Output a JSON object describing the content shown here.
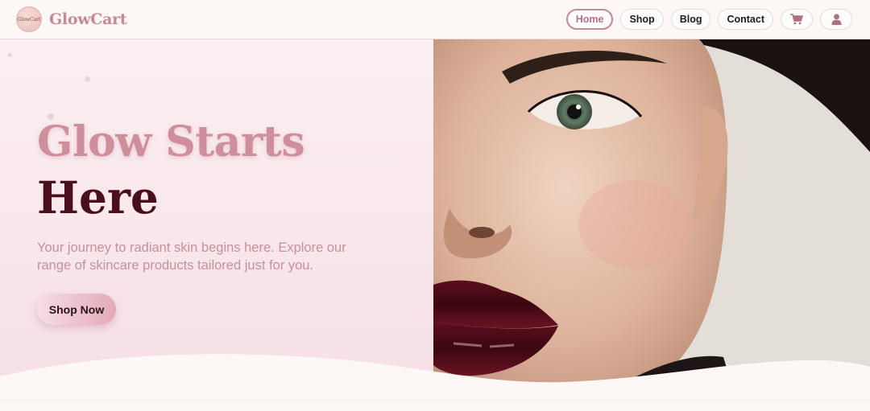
{
  "header": {
    "brand": "GlowCart",
    "logo_text": "GlowCart",
    "nav": [
      {
        "label": "Home",
        "active": true
      },
      {
        "label": "Shop",
        "active": false
      },
      {
        "label": "Blog",
        "active": false
      },
      {
        "label": "Contact",
        "active": false
      }
    ],
    "cart_icon": "cart-icon",
    "user_icon": "user-icon"
  },
  "hero": {
    "title_line1": "Glow Starts",
    "title_line2": "Here",
    "description": "Your journey to radiant skin begins here. Explore our range of skincare products tailored just for you.",
    "cta_label": "Shop Now",
    "image_subject": "close-up face with dark lipstick"
  },
  "colors": {
    "accent": "#c9849a",
    "title_light": "#cf8e9b",
    "title_dark": "#4a0f1c",
    "lip": "#4d0a17"
  }
}
